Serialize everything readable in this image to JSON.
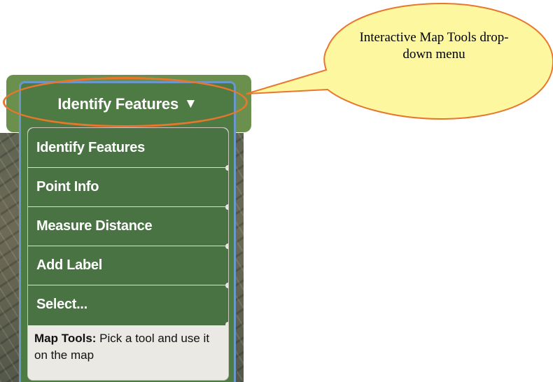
{
  "widget": {
    "toggle_label": "Identify Features",
    "caret": "▼",
    "menu_items": [
      {
        "label": "Identify Features"
      },
      {
        "label": "Point Info"
      },
      {
        "label": "Measure Distance"
      },
      {
        "label": "Add Label"
      },
      {
        "label": "Select..."
      }
    ],
    "help_prefix": "Map Tools:",
    "help_body": " Pick a tool and use it on the map"
  },
  "callout": {
    "text": "Interactive Map Tools drop-down menu"
  },
  "colors": {
    "header_green": "#6b8f4c",
    "menu_green": "#4a7344",
    "panel_border_blue": "#6a97c9",
    "highlight_orange": "#e8772e",
    "callout_fill": "#fdf8a0"
  },
  "icons": {
    "caret": "chevron-down-icon"
  }
}
